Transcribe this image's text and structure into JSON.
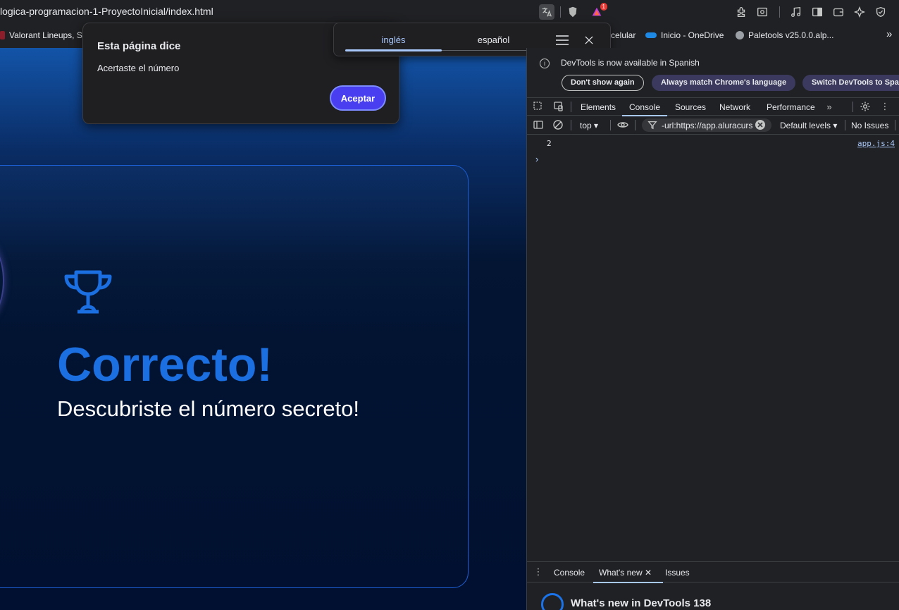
{
  "browser": {
    "url": "logica-programacion-1-ProyectoInicial/index.html",
    "extension_badge": "1",
    "bookmarks": [
      {
        "label": "Valorant Lineups, Se"
      },
      {
        "label": "celular"
      },
      {
        "label": "Inicio - OneDrive"
      },
      {
        "label": "Paletools v25.0.0.alp..."
      }
    ],
    "more_bookmarks": "»"
  },
  "page": {
    "title": "Correcto!",
    "subtitle": "Descubriste el número secreto!"
  },
  "alert": {
    "title": "Esta página dice",
    "message": "Acertaste el número",
    "button": "Aceptar"
  },
  "translate": {
    "lang_from": "inglés",
    "lang_to": "español"
  },
  "devtools": {
    "notice": "DevTools is now available in Spanish",
    "btn_dont_show": "Don't show again",
    "btn_match": "Always match Chrome's language",
    "btn_switch": "Switch DevTools to Spa",
    "tabs": [
      "Elements",
      "Console",
      "Sources",
      "Network",
      "Performance"
    ],
    "active_tab": "Console",
    "context": "top",
    "filter_value": "-url:https://app.aluracurs",
    "levels": "Default levels",
    "issues": "No Issues",
    "console_output": "2",
    "console_source": "app.js:4",
    "prompt": "›",
    "drawer_tabs": [
      "Console",
      "What's new",
      "Issues"
    ],
    "whats_new_title": "What's new in DevTools 138"
  },
  "colors": {
    "accent": "#1b6fe0",
    "alert_button": "#4a3ff0",
    "devtools_link": "#a8c7fa"
  }
}
